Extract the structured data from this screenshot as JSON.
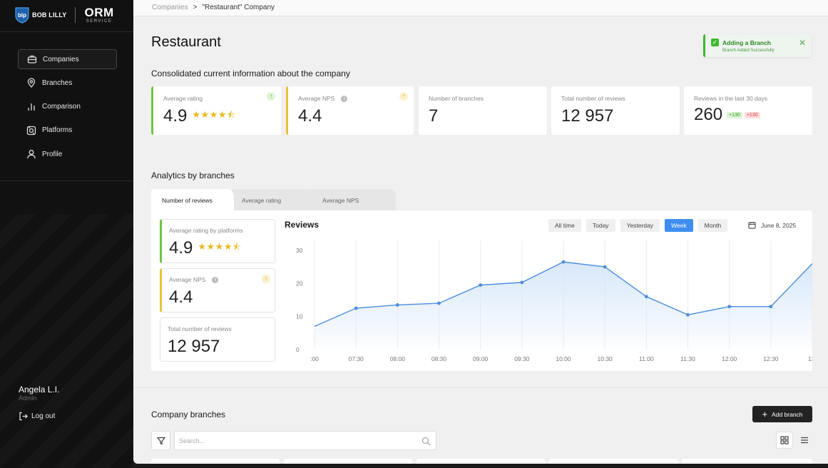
{
  "brand": {
    "left_logo": "BOB LILLY",
    "orm": "ORM",
    "orm_sub": "SERVICE"
  },
  "nav": [
    {
      "label": "Companies",
      "icon": "briefcase-icon",
      "active": true
    },
    {
      "label": "Branches",
      "icon": "location-pin-icon",
      "active": false
    },
    {
      "label": "Comparison",
      "icon": "bar-chart-icon",
      "active": false
    },
    {
      "label": "Platforms",
      "icon": "platforms-icon",
      "active": false
    },
    {
      "label": "Profile",
      "icon": "user-icon",
      "active": false
    }
  ],
  "user": {
    "name": "Angela L.I.",
    "role": "Admin",
    "logout": "Log out"
  },
  "breadcrumb": {
    "root": "Companies",
    "separator": ">",
    "current": "\"Restaurant\" Company"
  },
  "page": {
    "title": "Restaurant",
    "consolidated_title": "Consolidated current information about the company",
    "analytics_title": "Analytics by branches",
    "branches_title": "Company branches"
  },
  "toast": {
    "title": "Adding a Branch",
    "message": "Branch Added Successfully",
    "color": "#3cba2e"
  },
  "kpis": {
    "avg_rating": {
      "label": "Average rating",
      "value": "4.9",
      "stars": "★★★★⯪"
    },
    "avg_nps": {
      "label": "Average NPS",
      "value": "4.4"
    },
    "branches": {
      "label": "Number of branches",
      "value": "7"
    },
    "total_reviews": {
      "label": "Total number of reviews",
      "value": "12 957"
    },
    "reviews_30": {
      "label": "Reviews in the last 30 days",
      "value": "260",
      "delta_up": "+130",
      "delta_down": "+130"
    }
  },
  "tabs": [
    {
      "label": "Number of reviews",
      "active": true
    },
    {
      "label": "Average rating",
      "active": false
    },
    {
      "label": "Average NPS",
      "active": false
    }
  ],
  "mini": {
    "rating": {
      "label": "Average rating by platforms",
      "value": "4.9",
      "stars": "★★★★⯪"
    },
    "nps": {
      "label": "Average NPS",
      "value": "4.4"
    },
    "reviews": {
      "label": "Total number of reviews",
      "value": "12 957"
    }
  },
  "chart_controls": {
    "ranges": [
      "All time",
      "Today",
      "Yesterday",
      "Week",
      "Month"
    ],
    "active_range": "Week",
    "date": "June 8, 2025"
  },
  "chart_data": {
    "type": "area",
    "title": "Reviews",
    "x": [
      ":00",
      "07:30",
      "08:00",
      "08:30",
      "09:00",
      "09:30",
      "10:00",
      "10:30",
      "11:00",
      "11:30",
      "12:00",
      "12:30",
      "13:"
    ],
    "values": [
      7,
      12.5,
      13.5,
      14,
      19.5,
      20.3,
      26.5,
      25,
      16,
      10.5,
      13,
      13,
      26
    ],
    "yticks": [
      0,
      10,
      20,
      30
    ],
    "ylim": [
      0,
      33
    ],
    "line_color": "#4a8ee0",
    "fill_color": "#d6e6fa",
    "grid": "vertical"
  },
  "branches_section": {
    "add_label": "Add branch",
    "search_placeholder": "Search..."
  }
}
